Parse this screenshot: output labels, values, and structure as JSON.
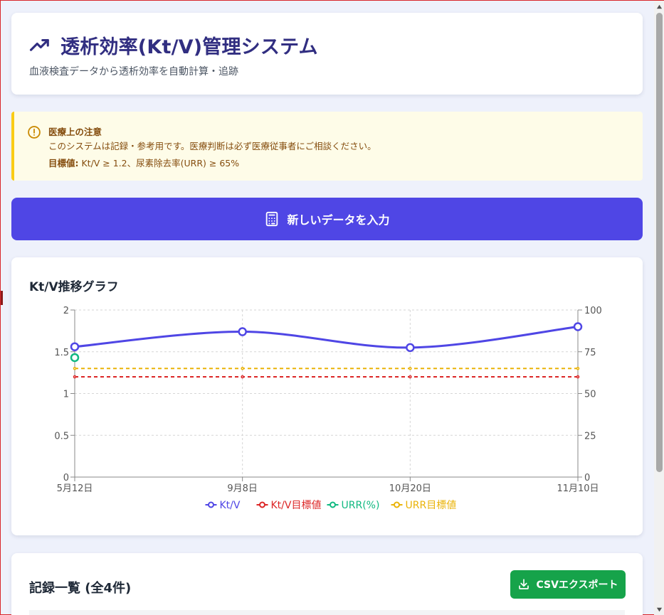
{
  "header": {
    "title": "透析効率(Kt/V)管理システム",
    "subtitle": "血液検査データから透析効率を自動計算・追跡",
    "icon": "trending-up-icon"
  },
  "notice": {
    "title": "医療上の注意",
    "body": "このシステムは記録・参考用です。医療判断は必ず医療従事者にご相談ください。",
    "target_label": "目標値:",
    "target_value": " Kt/V ≥ 1.2、尿素除去率(URR) ≥ 65%",
    "icon": "alert-circle-icon"
  },
  "actions": {
    "new_entry_label": "新しいデータを入力",
    "new_entry_icon": "calculator-icon"
  },
  "chart": {
    "title": "Kt/V推移グラフ"
  },
  "chart_data": {
    "type": "line",
    "categories": [
      "5月12日",
      "9月8日",
      "10月20日",
      "11月10日"
    ],
    "left_axis": {
      "ticks": [
        "0",
        "0.5",
        "1",
        "1.5",
        "2"
      ],
      "ylim": [
        0,
        2
      ]
    },
    "right_axis": {
      "ticks": [
        "0",
        "25",
        "50",
        "75",
        "100"
      ],
      "ylim": [
        0,
        100
      ]
    },
    "grid": true,
    "legend_position": "bottom",
    "series": [
      {
        "name": "Kt/V",
        "axis": "left",
        "values": [
          1.56,
          1.74,
          1.55,
          1.8
        ],
        "color": "#4f46e5",
        "style": "solid",
        "markers": true
      },
      {
        "name": "Kt/V目標値",
        "axis": "left",
        "values": [
          1.2,
          1.2,
          1.2,
          1.2
        ],
        "color": "#dc2626",
        "style": "dashed",
        "markers": false
      },
      {
        "name": "URR(%)",
        "axis": "right",
        "values": [
          71.5,
          null,
          null,
          null
        ],
        "color": "#10b981",
        "style": "solid",
        "markers": true
      },
      {
        "name": "URR目標値",
        "axis": "right",
        "values": [
          65,
          65,
          65,
          65
        ],
        "color": "#eab308",
        "style": "dashed",
        "markers": false
      }
    ]
  },
  "records": {
    "title": "記録一覧 (全4件)",
    "export_label": "CSVエクスポート",
    "export_icon": "download-icon"
  },
  "colors": {
    "primary": "#4f46e5",
    "success": "#16a34a",
    "warning_bg": "#fefce8",
    "warning_border": "#facc15",
    "title": "#312e81"
  }
}
